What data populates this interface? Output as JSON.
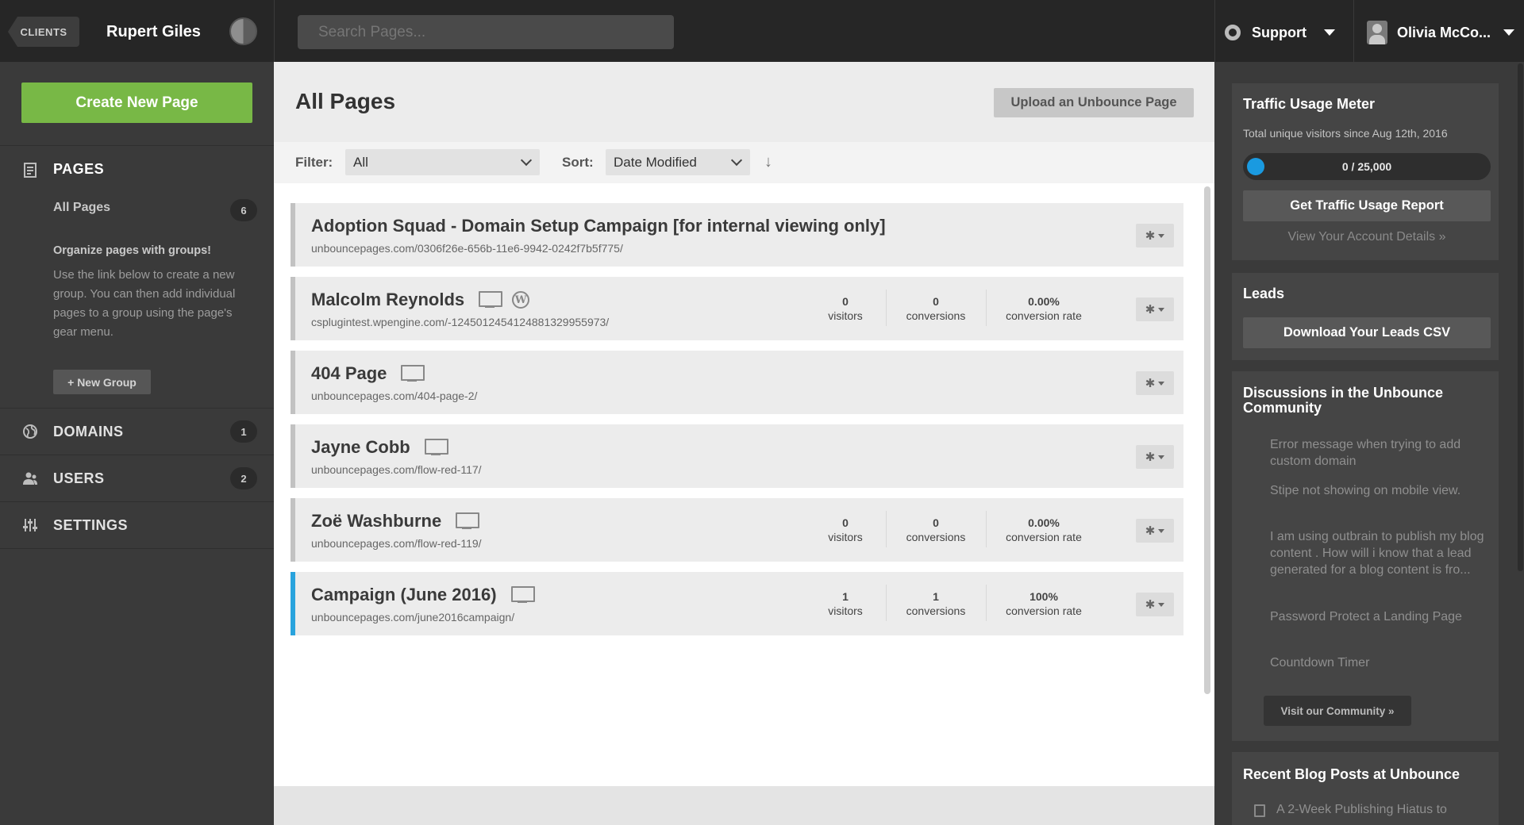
{
  "topbar": {
    "clients_label": "CLIENTS",
    "client_name": "Rupert Giles",
    "search_placeholder": "Search Pages...",
    "support_label": "Support",
    "user_name": "Olivia McCo..."
  },
  "sidebar": {
    "create_button": "Create New Page",
    "pages_label": "PAGES",
    "all_pages_label": "All Pages",
    "all_pages_count": "6",
    "group_tip_title": "Organize pages with groups!",
    "group_tip_body": "Use the link below to create a new group. You can then add individual pages to a group using the page's gear menu.",
    "new_group_button": "+ New Group",
    "domains_label": "DOMAINS",
    "domains_count": "1",
    "users_label": "USERS",
    "users_count": "2",
    "settings_label": "SETTINGS"
  },
  "main": {
    "title": "All Pages",
    "upload_button": "Upload an Unbounce Page",
    "filter_label": "Filter:",
    "filter_value": "All",
    "sort_label": "Sort:",
    "sort_value": "Date Modified",
    "sort_arrow": "↓",
    "pages": [
      {
        "title": "Adoption Squad - Domain Setup Campaign [for internal viewing only]",
        "url": "unbouncepages.com/0306f26e-656b-11e6-9942-0242f7b5f775/"
      },
      {
        "title": "Malcolm Reynolds",
        "url": "csplugintest.wpengine.com/-1245012454124881329955973/",
        "visitors": "0",
        "visitors_label": "visitors",
        "conversions": "0",
        "conversions_label": "conversions",
        "rate": "0.00%",
        "rate_label": "conversion rate"
      },
      {
        "title": "404 Page",
        "url": "unbouncepages.com/404-page-2/"
      },
      {
        "title": "Jayne Cobb",
        "url": "unbouncepages.com/flow-red-117/"
      },
      {
        "title": "Zoë Washburne",
        "url": "unbouncepages.com/flow-red-119/",
        "visitors": "0",
        "visitors_label": "visitors",
        "conversions": "0",
        "conversions_label": "conversions",
        "rate": "0.00%",
        "rate_label": "conversion rate"
      },
      {
        "title": "Campaign (June 2016)",
        "url": "unbouncepages.com/june2016campaign/",
        "visitors": "1",
        "visitors_label": "visitors",
        "conversions": "1",
        "conversions_label": "conversions",
        "rate": "100%",
        "rate_label": "conversion rate"
      }
    ],
    "wp_glyph": "W",
    "gear_glyph": "✱"
  },
  "right": {
    "traffic_title": "Traffic Usage Meter",
    "traffic_subtitle": "Total unique visitors since Aug 12th, 2016",
    "meter_value": "0 / 25,000",
    "meter_fraction": 0,
    "traffic_report_button": "Get Traffic Usage Report",
    "account_link": "View Your Account Details »",
    "leads_title": "Leads",
    "leads_button": "Download Your Leads CSV",
    "discussions_title": "Discussions in the Unbounce Community",
    "discussions": [
      "Error message when trying to add custom domain",
      "Stipe not showing on mobile view.",
      "I am using outbrain to publish my blog content . How will i know that a lead generated for a blog content is fro...",
      "Password Protect a Landing Page",
      "Countdown Timer"
    ],
    "community_button": "Visit our Community »",
    "blog_title": "Recent Blog Posts at Unbounce",
    "blog_posts": [
      "A 2-Week Publishing Hiatus to"
    ]
  },
  "colors": {
    "accent_green": "#78b846",
    "accent_blue": "#29a3dd",
    "topbar_bg": "#262626",
    "sidebar_bg": "#3a3a3a"
  }
}
